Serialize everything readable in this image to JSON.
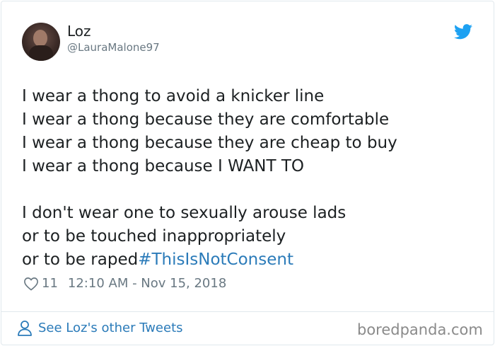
{
  "user": {
    "display_name": "Loz",
    "handle": "@LauraMalone97"
  },
  "tweet": {
    "lines": [
      "I wear a thong to avoid a knicker line",
      "I wear a thong because they are comfortable",
      "I wear a thong because they are cheap to buy",
      "I wear a thong because I WANT TO",
      "I don't wear one to sexually arouse lads",
      "or to be touched inappropriately",
      "or to be raped"
    ],
    "hashtag": "#ThisIsNotConsent"
  },
  "meta": {
    "likes": "11",
    "timestamp": "12:10 AM - Nov 15, 2018"
  },
  "footer": {
    "other_tweets_label": "See Loz's other Tweets",
    "watermark": "boredpanda.com"
  },
  "icons": {
    "logo": "twitter-bird-icon",
    "like": "heart-icon",
    "profile": "person-icon"
  },
  "colors": {
    "link": "#2b7bb9",
    "twitter_blue": "#1da1f2",
    "secondary_text": "#697882"
  }
}
